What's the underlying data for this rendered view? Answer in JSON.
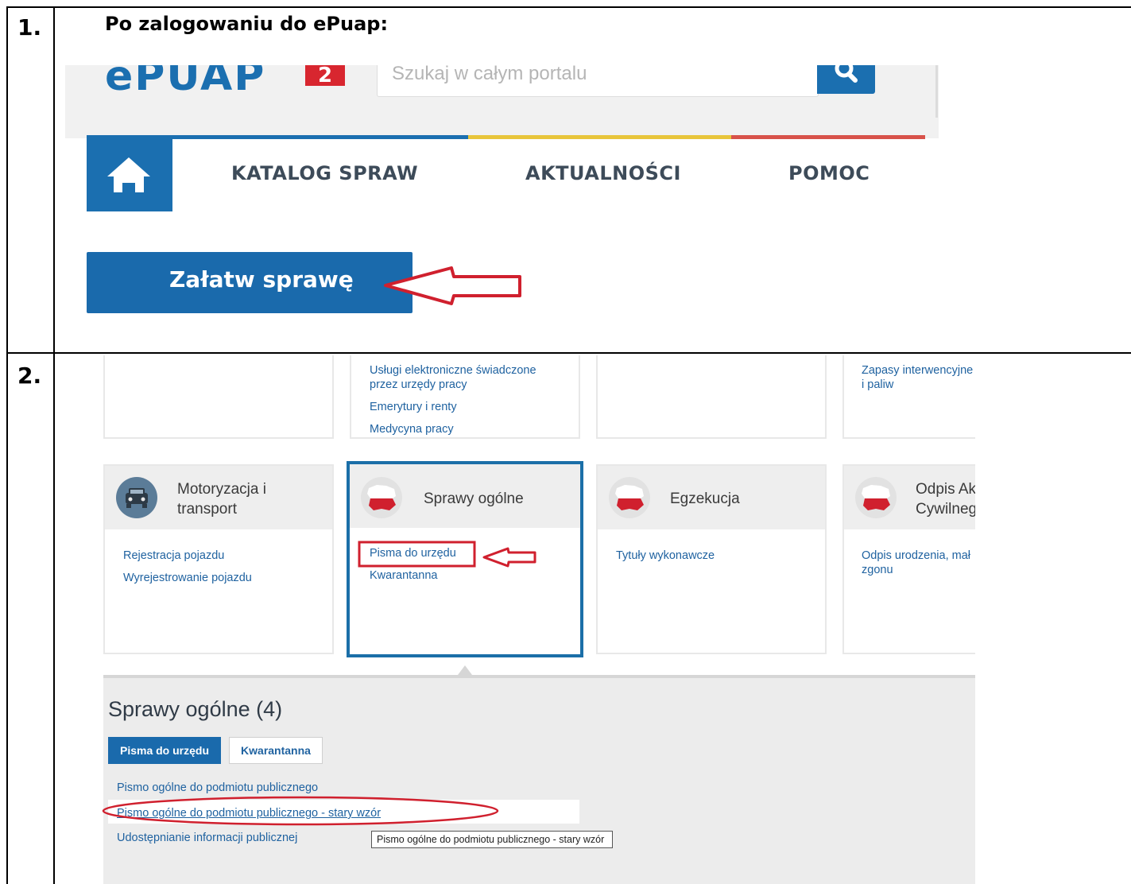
{
  "step1": {
    "number": "1.",
    "heading": "Po zalogowaniu do ePuap:",
    "logo_text": "ePUAP",
    "logo_badge": "2",
    "search_placeholder": "Szukaj w całym portalu",
    "nav": [
      "KATALOG SPRAW",
      "AKTUALNOŚCI",
      "POMOC"
    ],
    "button_label": "Załatw sprawę"
  },
  "step2": {
    "number": "2.",
    "top_cards": [
      {
        "links": []
      },
      {
        "links": [
          "Usługi elektroniczne świadczone\nprzez urzędy pracy",
          "Emerytury i renty",
          "Medycyna pracy"
        ]
      },
      {
        "links": []
      },
      {
        "links": [
          "Zapasy interwencyjne\ni paliw"
        ]
      }
    ],
    "cards": [
      {
        "title": "Motoryzacja i\ntransport",
        "icon": "car-icon",
        "links": [
          "Rejestracja pojazdu",
          "Wyrejestrowanie pojazdu"
        ]
      },
      {
        "title": "Sprawy ogólne",
        "icon": "poland-map-icon",
        "links": [
          "Pisma do urzędu",
          "Kwarantanna"
        ]
      },
      {
        "title": "Egzekucja",
        "icon": "poland-map-icon",
        "links": [
          "Tytuły wykonawcze"
        ]
      },
      {
        "title": "Odpis Ak\nCywilneg",
        "icon": "poland-map-icon",
        "links": [
          "Odpis urodzenia, mał\nzgonu"
        ]
      }
    ],
    "panel_title": "Sprawy ogólne (4)",
    "tabs": [
      "Pisma do urzędu",
      "Kwarantanna"
    ],
    "panel_links": [
      "Pismo ogólne do podmiotu publicznego",
      "Pismo ogólne do podmiotu publicznego - stary wzór",
      "Udostępnianie informacji publicznej"
    ],
    "tooltip": "Pismo ogólne do podmiotu publicznego - stary wzór"
  },
  "colors": {
    "brand_blue": "#1b6fb0",
    "highlight_red": "#d0202e",
    "line_yellow": "#e8c53a",
    "line_red": "#d8524a"
  }
}
